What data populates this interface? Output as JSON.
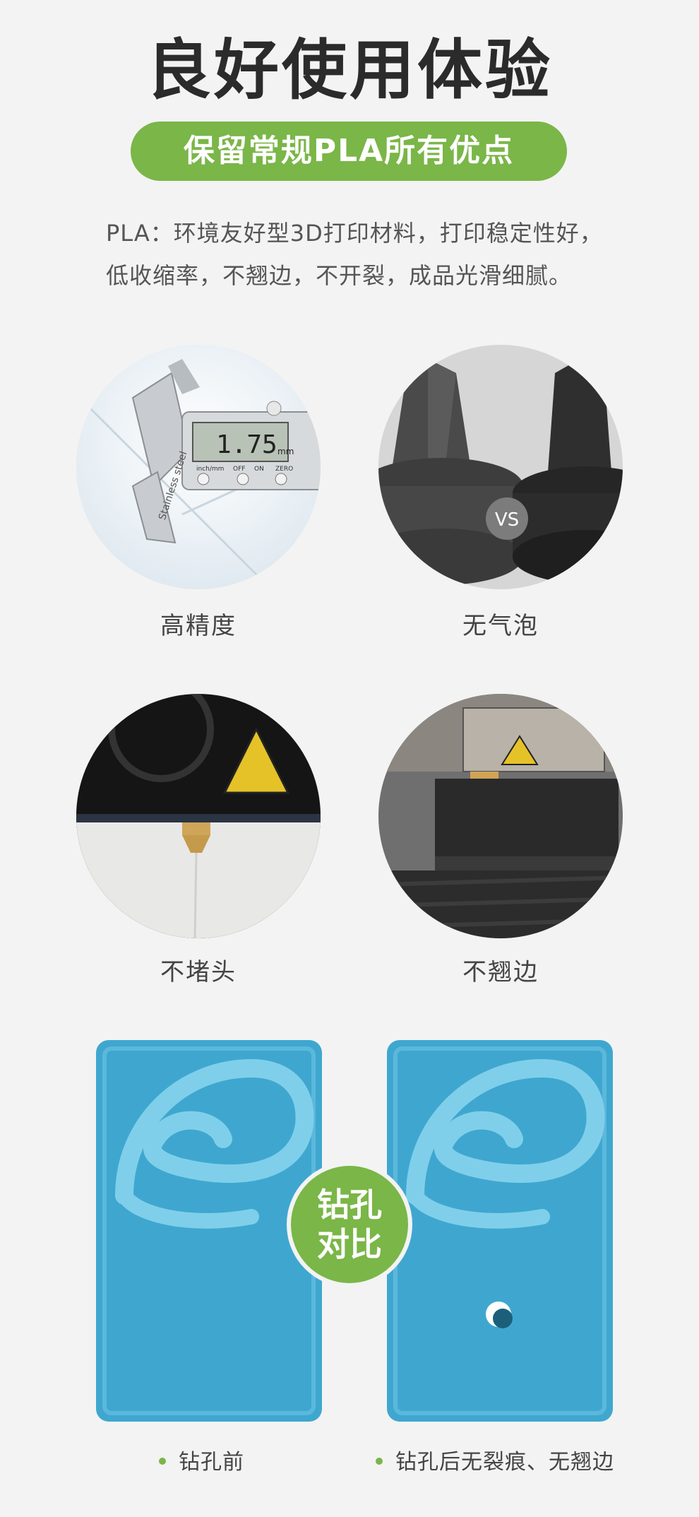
{
  "title": "良好使用体验",
  "subtitle": "保留常规PLA所有优点",
  "description": {
    "line1": "PLA：环境友好型3D打印材料，打印稳定性好，",
    "line2": "低收缩率，不翘边，不开裂，成品光滑细腻。"
  },
  "features": [
    {
      "label": "高精度",
      "image": "caliper-measuring-filament"
    },
    {
      "label": "无气泡",
      "image": "print-comparison-vs"
    },
    {
      "label": "不堵头",
      "image": "nozzle-extruding"
    },
    {
      "label": "不翘边",
      "image": "printing-box-on-bed"
    }
  ],
  "caliper_reading": "1.75",
  "caliper_unit": "mm",
  "caliper_brand": "Stainless steel",
  "caliper_buttons": [
    "inch/mm",
    "OFF",
    "ON",
    "ZERO"
  ],
  "vs_label": "VS",
  "comparison": {
    "badge_line1": "钻孔",
    "badge_line2": "对比",
    "before_label": "钻孔前",
    "after_label": "钻孔后无裂痕、无翘边"
  },
  "colors": {
    "accent": "#7ab648",
    "background": "#f3f3f3",
    "title": "#2b2b2b",
    "print_blue": "#3fa7cf"
  }
}
